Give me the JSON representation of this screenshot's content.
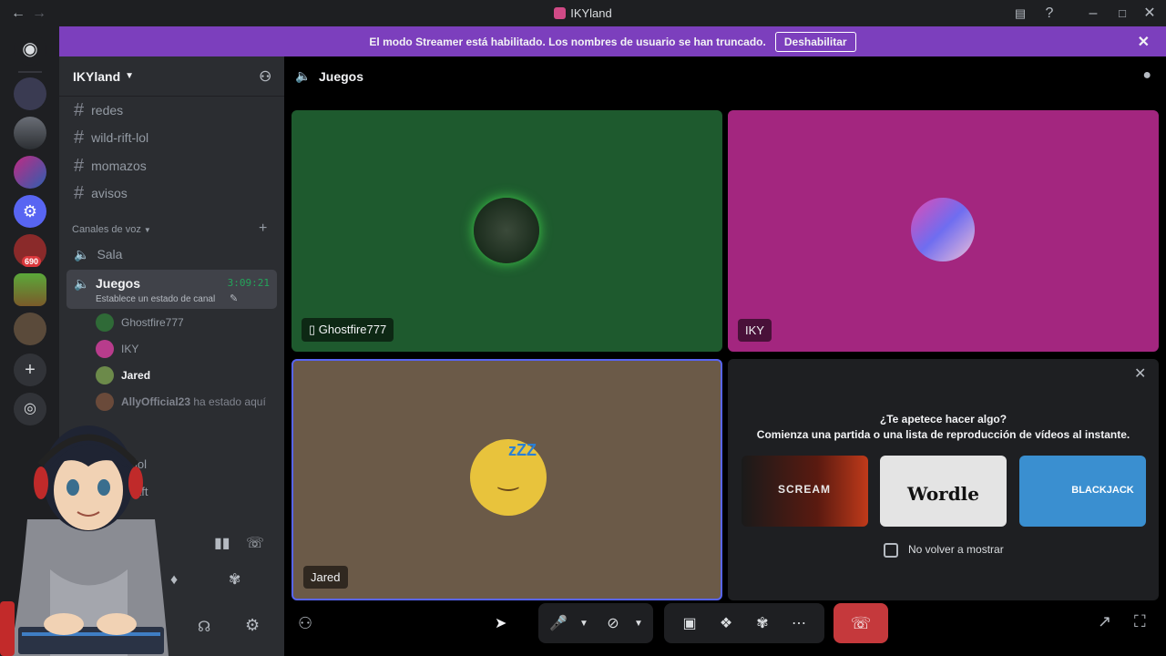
{
  "window": {
    "title": "IKYland",
    "back_icon": "arrow-left-icon",
    "forward_icon": "arrow-right-icon"
  },
  "banner": {
    "text": "El modo Streamer está habilitado. Los nombres de usuario se han truncado.",
    "button": "Deshabilitar",
    "accent": "#7c3fbd"
  },
  "server": {
    "name": "IKYland"
  },
  "text_channels": [
    "redes",
    "wild-rift-lol",
    "momazos",
    "avisos"
  ],
  "voice_category": "Canales de voz",
  "voice_channels": [
    {
      "name": "Sala"
    },
    {
      "name": "Juegos",
      "timer": "3:09:21",
      "status": "Establece un estado de canal"
    }
  ],
  "voice_users": [
    "Ghostfire777",
    "IKY",
    "Jared"
  ],
  "ally": {
    "name": "AllyOfficial23",
    "suffix": "ha estado aquí"
  },
  "partial_channels": [
    "lol",
    "aft"
  ],
  "rail": {
    "badge": "690"
  },
  "main": {
    "channel": "Juegos"
  },
  "tiles": [
    {
      "name": "Ghostfire777",
      "color": "#1e5a2e",
      "device_icon": "phone-icon"
    },
    {
      "name": "IKY",
      "color": "#a3267f"
    },
    {
      "name": "Jared",
      "color": "#6b5a48"
    }
  ],
  "activity": {
    "title": "¿Te apetece hacer algo?",
    "subtitle": "Comienza una partida o una lista de reproducción de vídeos al instante.",
    "checkbox": "No volver a mostrar",
    "cards": [
      {
        "label": "SCREAM"
      },
      {
        "label": "Wordle"
      },
      {
        "label": "BLACKJACK"
      }
    ]
  },
  "colors": {
    "end_call": "#c5393c",
    "speaking": "#23a55a"
  }
}
